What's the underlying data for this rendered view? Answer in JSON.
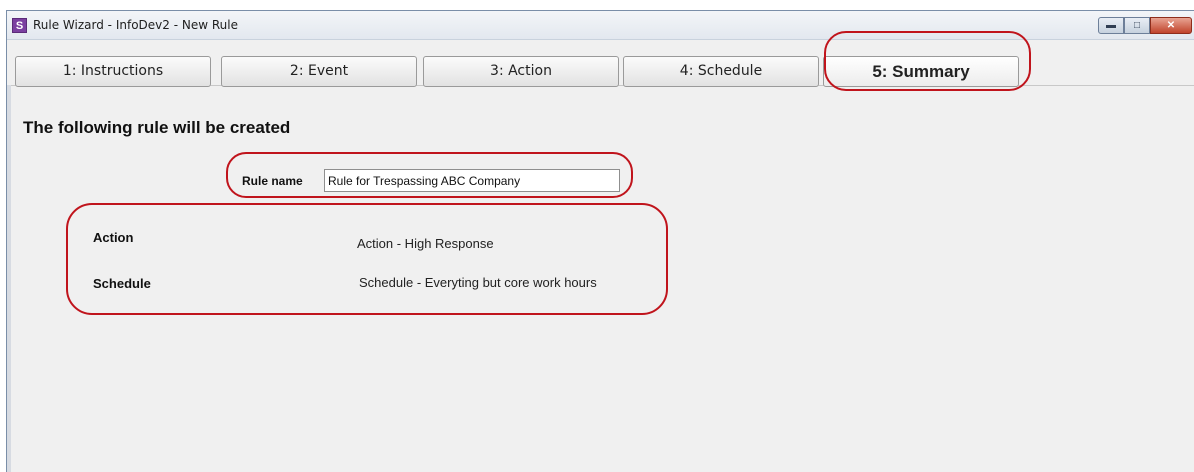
{
  "window": {
    "title": "Rule Wizard - InfoDev2 - New Rule",
    "app_icon_letter": "S"
  },
  "tabs": [
    {
      "label": "1: Instructions",
      "active": false
    },
    {
      "label": "2: Event",
      "active": false
    },
    {
      "label": "3: Action",
      "active": false
    },
    {
      "label": "4: Schedule",
      "active": false
    },
    {
      "label": "5: Summary",
      "active": true
    }
  ],
  "summary": {
    "heading": "The following rule will be created",
    "rule_name_label": "Rule name",
    "rule_name_value": "Rule for Trespassing ABC Company",
    "action_label": "Action",
    "action_value": "Action - High Response",
    "schedule_label": "Schedule",
    "schedule_value": "Schedule - Everyting but core work hours"
  },
  "colors": {
    "highlight_ring": "#c0141c",
    "window_bg": "#f0f0f0"
  }
}
